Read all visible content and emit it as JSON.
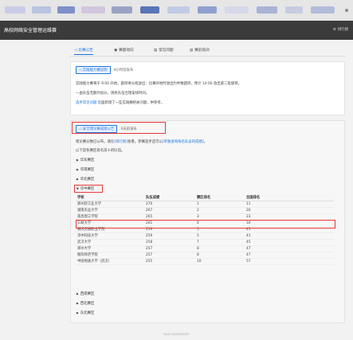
{
  "header": {
    "title": "高校网络安全管理运维赛",
    "ranking_label": "排行榜"
  },
  "tabs": [
    {
      "label": "比赛公告",
      "icon": "megaphone-icon"
    },
    {
      "label": "赛题动向",
      "icon": "notebook-icon"
    },
    {
      "label": "常见问题",
      "icon": "document-icon"
    },
    {
      "label": "赛前培训",
      "icon": "document-icon"
    }
  ],
  "announcement1": {
    "chip": "实践能力赛说明",
    "time": "8小时前发布",
    "lines": [
      "实践能力赛将于 9:00 开始。题目将分批放出：比赛开始时放出约半数题目，预计 14:00 放出第二批题目。",
      "一血队伍无额外加分，请各队伍合理安排时间。"
    ],
    "faq_link": "选手常见问题",
    "faq_rest": " 页面新增了一些实践赛相关问题，供参考。"
  },
  "announcement2": {
    "chip": "安全理论赛成绩公告",
    "time": "6天前发布",
    "line1_a": "理论赛分数已公布，请在",
    "line1_link1": "[排行榜]",
    "line1_b": "查看。参赛选手还可以",
    "line1_link2": "[单独查询每名队员的成绩]",
    "line1_c": "。",
    "line2": "以下是各赛区排名前十的队伍。"
  },
  "regions_before": [
    "华东赛区",
    "华南赛区",
    "华北赛区"
  ],
  "region_open": "华中赛区",
  "regions_after": [
    "西南赛区",
    "西北赛区",
    "东北赛区"
  ],
  "table": {
    "headers": [
      "学校",
      "队伍成绩",
      "赛区排名",
      "全国排名"
    ],
    "rows": [
      [
        "郑州轻工业大学",
        "270",
        "1",
        "11"
      ],
      [
        "湖南农业大学",
        "267",
        "2",
        "20"
      ],
      [
        "南昌理工学院",
        "265",
        "3",
        "23"
      ],
      [
        "三峡大学",
        "261",
        "4",
        "34"
      ],
      [
        "黄冈交通职业学院",
        "259",
        "5",
        "41"
      ],
      [
        "华中科技大学",
        "259",
        "5",
        "41"
      ],
      [
        "武汉大学",
        "258",
        "7",
        "45"
      ],
      [
        "郑州大学",
        "257",
        "8",
        "47"
      ],
      [
        "衡阳师范学院",
        "257",
        "8",
        "47"
      ],
      [
        "中国地质大学（武汉）",
        "255",
        "10",
        "57"
      ]
    ]
  },
  "footer": "BLUE DAVENPORT"
}
